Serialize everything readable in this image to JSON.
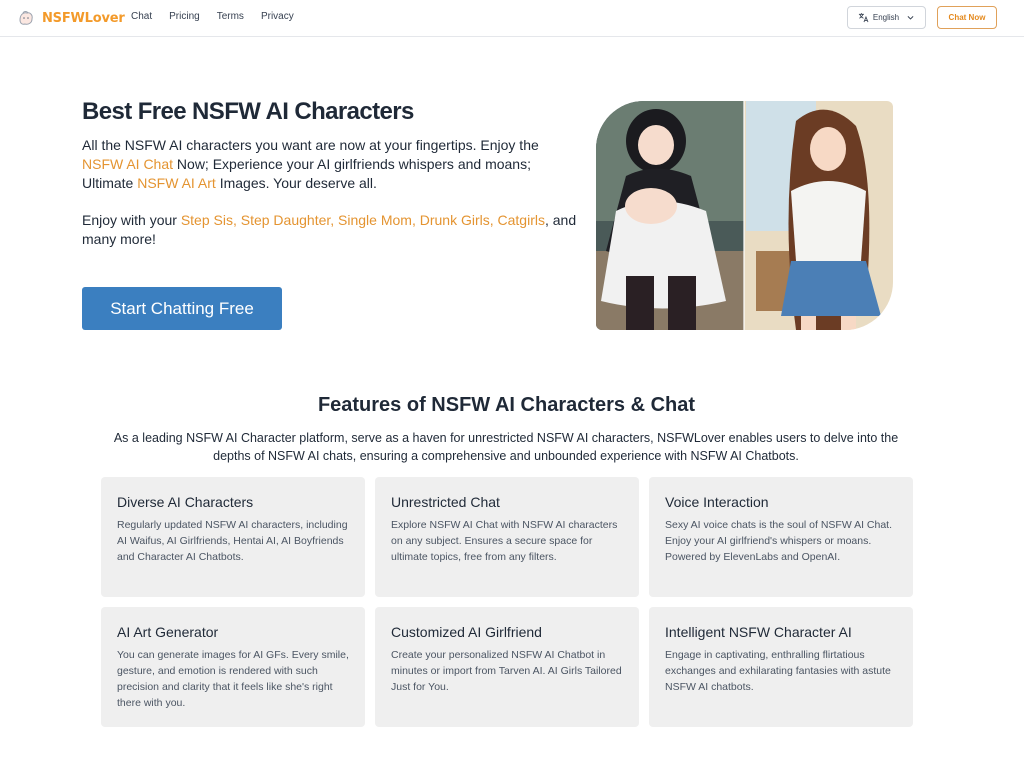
{
  "header": {
    "logo_text": "NSFWLover",
    "nav": [
      "Chat",
      "Pricing",
      "Terms",
      "Privacy"
    ],
    "language": "English",
    "chat_now": "Chat Now"
  },
  "hero": {
    "title": "Best Free NSFW AI Characters",
    "p1_a": "All the NSFW AI characters you want are now at your fingertips. Enjoy the ",
    "p1_link1": "NSFW AI Chat",
    "p1_b": " Now; Experience your AI girlfriends whispers and moans; Ultimate ",
    "p1_link2": "NSFW AI Art",
    "p1_c": " Images. Your deserve all.",
    "p2_a": "Enjoy with your ",
    "p2_links": "Step Sis, Step Daughter, Single Mom, Drunk Girls, Catgirls",
    "p2_b": ", and many more!",
    "cta": "Start Chatting Free"
  },
  "features": {
    "title": "Features of NSFW AI Characters & Chat",
    "description": "As a leading NSFW AI Character platform, serve as a haven for unrestricted NSFW AI characters, NSFWLover enables users to delve into the depths of NSFW AI chats, ensuring a comprehensive and unbounded experience with NSFW AI Chatbots.",
    "cards": [
      {
        "title": "Diverse AI Characters",
        "text": "Regularly updated NSFW AI characters, including AI Waifus, AI Girlfriends, Hentai AI, AI Boyfriends and Character AI Chatbots."
      },
      {
        "title": "Unrestricted Chat",
        "text": "Explore NSFW AI Chat with NSFW AI characters on any subject. Ensures a secure space for ultimate topics, free from any filters."
      },
      {
        "title": "Voice Interaction",
        "text": "Sexy AI voice chats is the soul of NSFW AI Chat. Enjoy your AI girlfriend's whispers or moans. Powered by ElevenLabs and OpenAI."
      },
      {
        "title": "AI Art Generator",
        "text": "You can generate images for AI GFs. Every smile, gesture, and emotion is rendered with such precision and clarity that it feels like she's right there with you."
      },
      {
        "title": "Customized AI Girlfriend",
        "text": "Create your personalized NSFW AI Chatbot in minutes or import from Tarven AI. AI Girls Tailored Just for You."
      },
      {
        "title": "Intelligent NSFW Character AI",
        "text": "Engage in captivating, enthralling flirtatious exchanges and exhilarating fantasies with astute NSFW AI chatbots."
      }
    ]
  },
  "colors": {
    "brand_orange": "#f39a2a",
    "cta_blue": "#3b7fc0",
    "card_bg": "#efefef"
  },
  "icons": [
    "logo-icon",
    "translate-icon",
    "chevron-down-icon"
  ]
}
